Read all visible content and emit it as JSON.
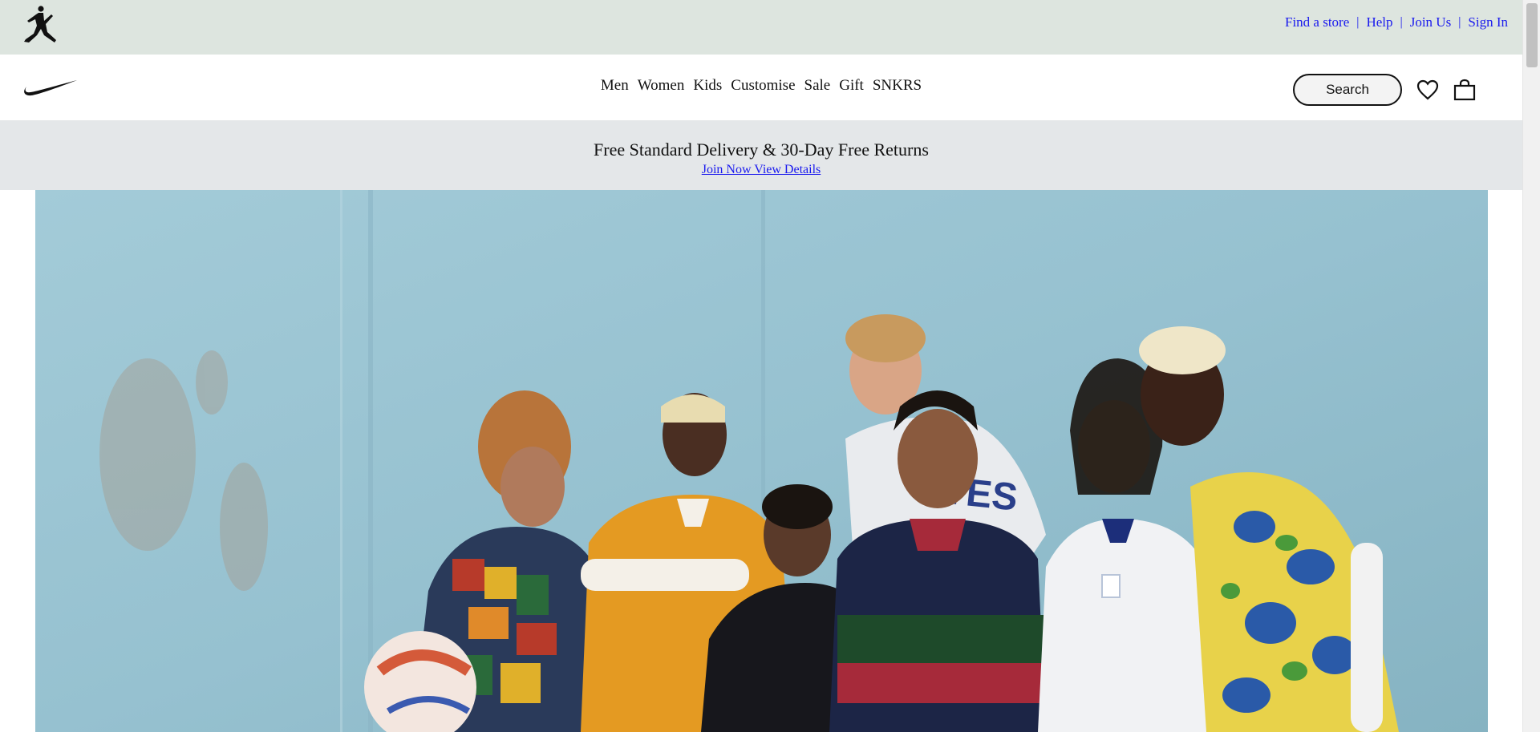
{
  "utility": {
    "logo_icon": "jordan-jumpman-icon",
    "links": [
      "Find a store",
      "Help",
      "Join Us",
      "Sign In"
    ],
    "separator": "|",
    "link_color": "#1a1aee",
    "background": "#dde5df"
  },
  "nav": {
    "logo_icon": "nike-swoosh-icon",
    "links": [
      "Men",
      "Women",
      "Kids",
      "Customise",
      "Sale",
      "Gift",
      "SNKRS"
    ],
    "search_label": "Search",
    "favorites_icon": "heart-icon",
    "bag_icon": "shopping-bag-icon"
  },
  "promo": {
    "title": "Free Standard Delivery & 30-Day Free Returns",
    "links": "Join Now View Details",
    "background": "#e4e7e9"
  },
  "hero": {
    "image": "group-of-people-in-football-shirts-photo"
  }
}
